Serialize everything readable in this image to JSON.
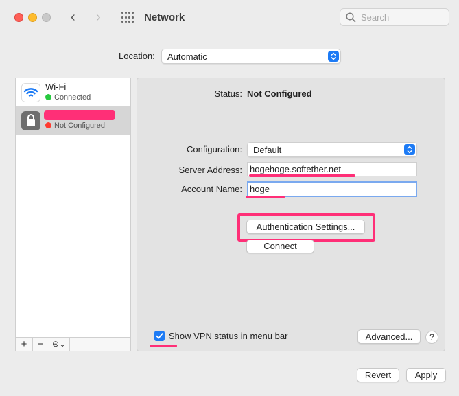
{
  "window": {
    "title": "Network"
  },
  "search": {
    "placeholder": "Search"
  },
  "location": {
    "label": "Location:",
    "value": "Automatic"
  },
  "services": [
    {
      "name": "Wi-Fi",
      "status": "Connected",
      "status_color": "#27c93f",
      "icon": "wifi-icon"
    },
    {
      "name": "",
      "status": "Not Configured",
      "status_color": "#ff3b30",
      "icon": "lock-icon"
    }
  ],
  "sidebar_toolbar": {
    "add": "+",
    "remove": "−",
    "action": "⊝⌄"
  },
  "detail": {
    "status_label": "Status:",
    "status_value": "Not Configured",
    "configuration_label": "Configuration:",
    "configuration_value": "Default",
    "server_address_label": "Server Address:",
    "server_address_value": "hogehoge.softether.net",
    "account_name_label": "Account Name:",
    "account_name_value": "hoge",
    "auth_settings_button": "Authentication Settings...",
    "connect_button": "Connect",
    "show_vpn_label": "Show VPN status in menu bar",
    "show_vpn_checked": true,
    "advanced_button": "Advanced...",
    "help_button": "?"
  },
  "footer": {
    "revert_button": "Revert",
    "apply_button": "Apply"
  },
  "colors": {
    "accent": "#1d7bf5",
    "annotation": "#ff2f77"
  }
}
